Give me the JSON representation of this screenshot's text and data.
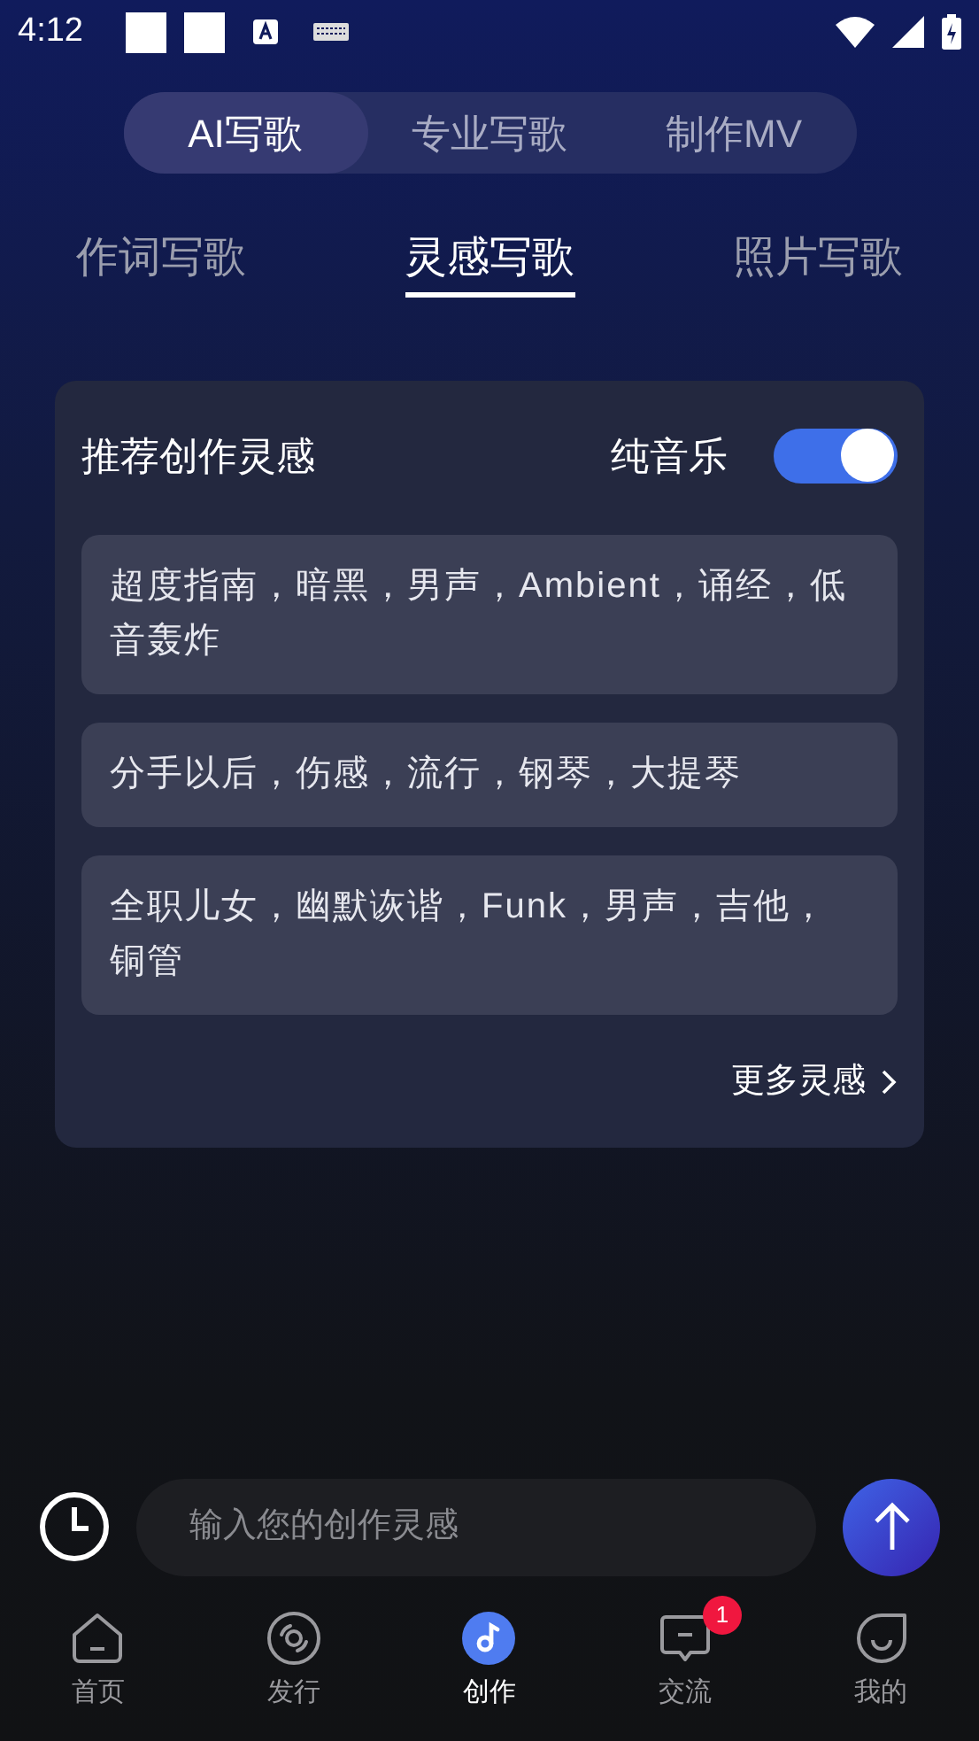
{
  "status_bar": {
    "time": "4:12"
  },
  "mode_tabs": [
    {
      "label": "AI写歌",
      "selected": true
    },
    {
      "label": "专业写歌",
      "selected": false
    },
    {
      "label": "制作MV",
      "selected": false
    }
  ],
  "sub_tabs": [
    {
      "label": "作词写歌",
      "selected": false
    },
    {
      "label": "灵感写歌",
      "selected": true
    },
    {
      "label": "照片写歌",
      "selected": false
    }
  ],
  "card": {
    "title": "推荐创作灵感",
    "toggle": {
      "label": "纯音乐",
      "on": true
    },
    "suggestions": [
      "超度指南，暗黑，男声，Ambient，诵经，低音轰炸",
      "分手以后，伤感，流行，钢琴，大提琴",
      "全职儿女，幽默诙谐，Funk，男声，吉他，铜管"
    ],
    "more": "更多灵感"
  },
  "input": {
    "placeholder": "输入您的创作灵感"
  },
  "nav": [
    {
      "label": "首页",
      "kind": "home",
      "selected": false
    },
    {
      "label": "发行",
      "kind": "disc",
      "selected": false
    },
    {
      "label": "创作",
      "kind": "note",
      "selected": true
    },
    {
      "label": "交流",
      "kind": "chat",
      "selected": false,
      "badge": "1"
    },
    {
      "label": "我的",
      "kind": "face",
      "selected": false
    }
  ]
}
